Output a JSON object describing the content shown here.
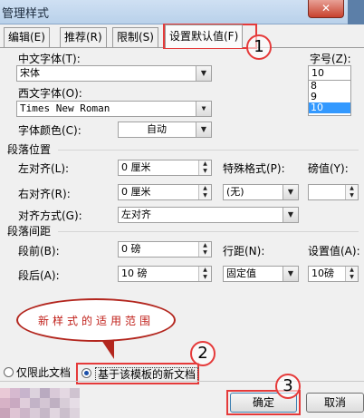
{
  "window": {
    "title": "管理样式",
    "close_glyph": "✕"
  },
  "tabs": [
    "编辑(E)",
    "推荐(R)",
    "限制(S)",
    "设置默认值(F)"
  ],
  "font": {
    "chinese_label": "中文字体(T):",
    "chinese_value": "宋体",
    "western_label": "西文字体(O):",
    "western_value": "Times New Roman",
    "color_label": "字体颜色(C):",
    "color_value": "自动"
  },
  "size": {
    "label": "字号(Z):",
    "value": "10",
    "options": [
      "8",
      "9",
      "10"
    ],
    "selected": "10"
  },
  "paragraph_position": {
    "heading": "段落位置",
    "left_label": "左对齐(L):",
    "left_value": "0 厘米",
    "right_label": "右对齐(R):",
    "right_value": "0 厘米",
    "special_label": "特殊格式(P):",
    "special_value": "(无)",
    "amount_label": "磅值(Y):",
    "amount_value": "",
    "align_label": "对齐方式(G):",
    "align_value": "左对齐"
  },
  "paragraph_spacing": {
    "heading": "段落间距",
    "before_label": "段前(B):",
    "before_value": "0 磅",
    "after_label": "段后(A):",
    "after_value": "10 磅",
    "line_label": "行距(N):",
    "line_value": "固定值",
    "setting_label": "设置值(A):",
    "setting_value": "10磅"
  },
  "scope": {
    "option_doc": "仅限此文档",
    "option_template": "基于该模板的新文档",
    "selected": "option_template"
  },
  "buttons": {
    "ok": "确定",
    "cancel": "取消"
  },
  "annotations": {
    "callout_1": "1",
    "callout_2": "2",
    "callout_3": "3",
    "cloud": "新样式的适用范围"
  },
  "colors": {
    "highlight_red": "#e53a3a",
    "cloud_text": "#c0201a",
    "selection": "#3399ff"
  },
  "icons": {
    "dropdown": "▼",
    "spin_up": "▲",
    "spin_down": "▼"
  }
}
